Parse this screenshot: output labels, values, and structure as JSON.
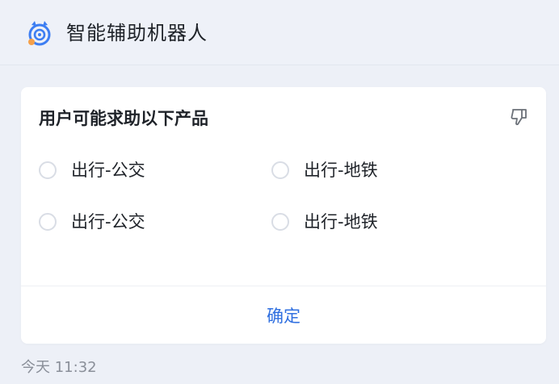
{
  "header": {
    "title": "智能辅助机器人",
    "icon": "robot-icon"
  },
  "card": {
    "title": "用户可能求助以下产品",
    "feedback_icon": "thumbs-down-icon",
    "options": [
      {
        "label": "出行-公交",
        "selected": false
      },
      {
        "label": "出行-地铁",
        "selected": false
      },
      {
        "label": "出行-公交",
        "selected": false
      },
      {
        "label": "出行-地铁",
        "selected": false
      }
    ],
    "confirm_label": "确定"
  },
  "message": {
    "timestamp": "今天 11:32"
  },
  "colors": {
    "accent": "#2f6fe0",
    "icon_orange": "#f5a04a",
    "icon_blue": "#3d7ef2"
  }
}
